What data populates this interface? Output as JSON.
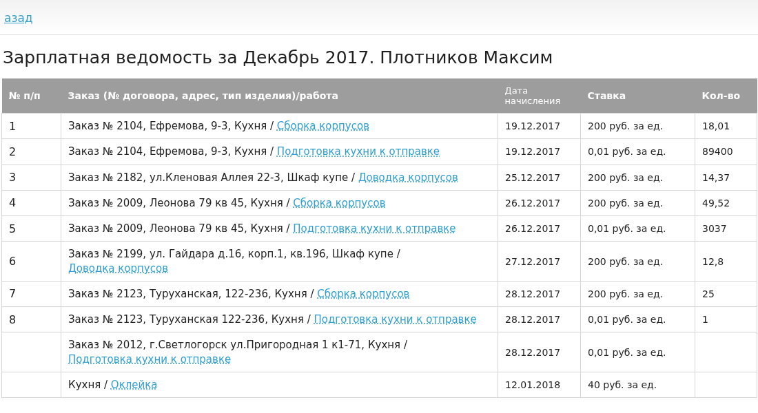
{
  "back_link": "азад",
  "title": "Зарплатная ведомость за Декабрь 2017. Плотников Максим",
  "table": {
    "columns": [
      "№ п/п",
      "Заказ (№ договора, адрес, тип изделия)/работа",
      "Дата начисления",
      "Ставка",
      "Кол-во"
    ],
    "rows": [
      {
        "number": "1",
        "order": "Заказ № 2104, Ефремова, 9-3, Кухня /",
        "work": "Сборка корпусов",
        "date": "19.12.2017",
        "rate": "200 руб. за ед.",
        "quantity": "18,01"
      },
      {
        "number": "2",
        "order": "Заказ № 2104, Ефремова, 9-3, Кухня /",
        "work": "Подготовка кухни к отправке",
        "date": "19.12.2017",
        "rate": "0,01 руб. за ед.",
        "quantity": "89400"
      },
      {
        "number": "3",
        "order": "Заказ № 2182, ул.Кленовая Аллея 22-3, Шкаф купе /",
        "work": "Доводка корпусов",
        "date": "25.12.2017",
        "rate": "200 руб. за ед.",
        "quantity": "14,37"
      },
      {
        "number": "4",
        "order": "Заказ № 2009, Леонова 79 кв 45, Кухня /",
        "work": "Сборка корпусов",
        "date": "26.12.2017",
        "rate": "200 руб. за ед.",
        "quantity": "49,52"
      },
      {
        "number": "5",
        "order": "Заказ № 2009, Леонова 79 кв 45, Кухня /",
        "work": "Подготовка кухни к отправке",
        "date": "26.12.2017",
        "rate": "0,01 руб. за ед.",
        "quantity": "3037"
      },
      {
        "number": "6",
        "order": "Заказ № 2199, ул. Гайдара д.16, корп.1, кв.196, Шкаф купе /",
        "work": "Доводка корпусов",
        "date": "27.12.2017",
        "rate": "200 руб. за ед.",
        "quantity": "12,8"
      },
      {
        "number": "7",
        "order": "Заказ № 2123, Туруханская, 122-236, Кухня /",
        "work": "Сборка корпусов",
        "date": "28.12.2017",
        "rate": "200 руб. за ед.",
        "quantity": "25"
      },
      {
        "number": "8",
        "order": "Заказ № 2123, Туруханская 122-236, Кухня /",
        "work": "Подготовка кухни к отправке",
        "date": "28.12.2017",
        "rate": "0,01 руб. за ед.",
        "quantity": "1"
      },
      {
        "order": "Заказ № 2012, г.Светлогорск ул.Пригородная 1 к1-71, Кухня /",
        "work": "Подготовка кухни к отправке",
        "date": "28.12.2017",
        "rate": "0,01 руб. за ед."
      },
      {
        "order": "Кухня /",
        "work": "Оклейка",
        "date": "12.01.2018",
        "rate": "40 руб. за ед."
      }
    ]
  }
}
